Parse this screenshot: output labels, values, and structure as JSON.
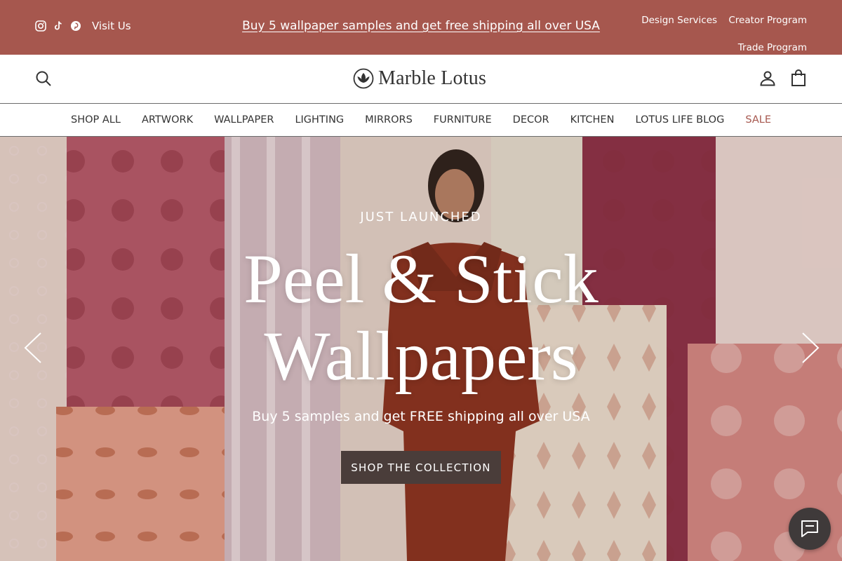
{
  "topbar": {
    "visit_label": "Visit Us",
    "promo": "Buy 5 wallpaper samples and get free shipping all over USA",
    "links": [
      "Design Services",
      "Creator Program",
      "Trade Program"
    ],
    "social_icons": [
      "instagram-icon",
      "tiktok-icon",
      "pinterest-icon"
    ],
    "bg_color": "#a6574e"
  },
  "header": {
    "brand": "Marble Lotus",
    "icons": [
      "search-icon",
      "lotus-logo-icon",
      "account-icon",
      "cart-icon"
    ]
  },
  "nav": {
    "items": [
      "SHOP ALL",
      "ARTWORK",
      "WALLPAPER",
      "LIGHTING",
      "MIRRORS",
      "FURNITURE",
      "DECOR",
      "KITCHEN",
      "LOTUS LIFE BLOG",
      "SALE"
    ],
    "sale_color": "#a6574e"
  },
  "hero": {
    "eyebrow": "JUST LAUNCHED",
    "title_line1": "Peel & Stick",
    "title_line2": "Wallpapers",
    "subtitle": "Buy 5 samples and get FREE shipping all over USA",
    "cta": "SHOP THE COLLECTION",
    "cta_color": "#4a3d3a",
    "icons": [
      "chevron-left-icon",
      "chevron-right-icon"
    ]
  },
  "chat": {
    "icon": "chat-bubble-icon"
  }
}
